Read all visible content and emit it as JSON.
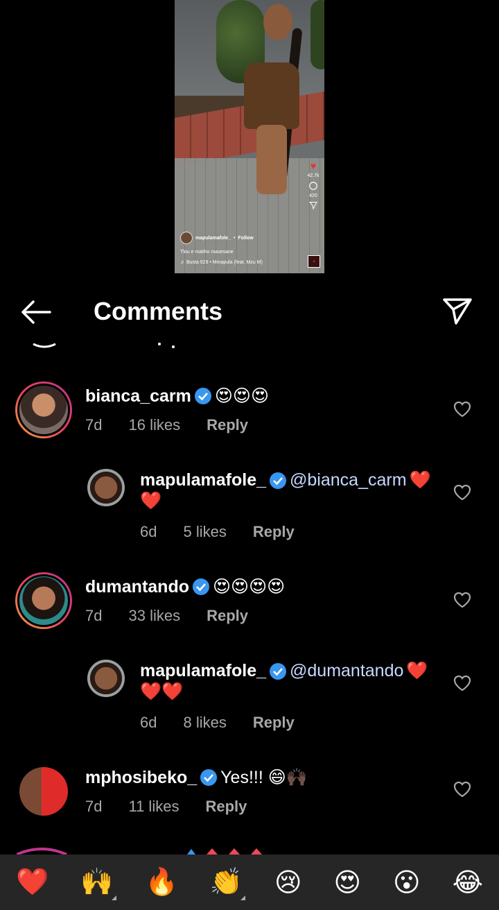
{
  "video": {
    "stats": {
      "likes": "42.7k",
      "comments": "420"
    },
    "caption_user": "mapulamafole_",
    "follow": "Follow",
    "caption": "Tlou e matiho masesane",
    "music": "♬ Busta 929 • Mmapula (feat. Mzu M)"
  },
  "header": {
    "title": "Comments"
  },
  "comments": [
    {
      "username": "bianca_carm",
      "text": "😍😍😍",
      "age": "7d",
      "likes": "16 likes",
      "reply": "Reply"
    },
    {
      "username": "mapulamafole_",
      "mention": "@bianca_carm",
      "text": "❤️",
      "text2": "❤️",
      "age": "6d",
      "likes": "5 likes",
      "reply": "Reply"
    },
    {
      "username": "dumantando",
      "text": "😍😍😍😍",
      "age": "7d",
      "likes": "33 likes",
      "reply": "Reply"
    },
    {
      "username": "mapulamafole_",
      "mention": "@dumantando",
      "text": "❤️",
      "text2": "❤️❤️",
      "age": "6d",
      "likes": "8 likes",
      "reply": "Reply"
    },
    {
      "username": "mphosibeko_",
      "text": "Yes!!! 😄🙌🏿",
      "age": "7d",
      "likes": "11 likes",
      "reply": "Reply"
    }
  ],
  "emoji_bar": [
    "❤️",
    "🙌",
    "🔥",
    "👏",
    "😢",
    "😍",
    "😮",
    "😂"
  ],
  "colors": {
    "background": "#000000",
    "verified": "#3897f0",
    "heart": "#ed4956",
    "muted": "#a8a8a8",
    "bar": "#262626"
  }
}
